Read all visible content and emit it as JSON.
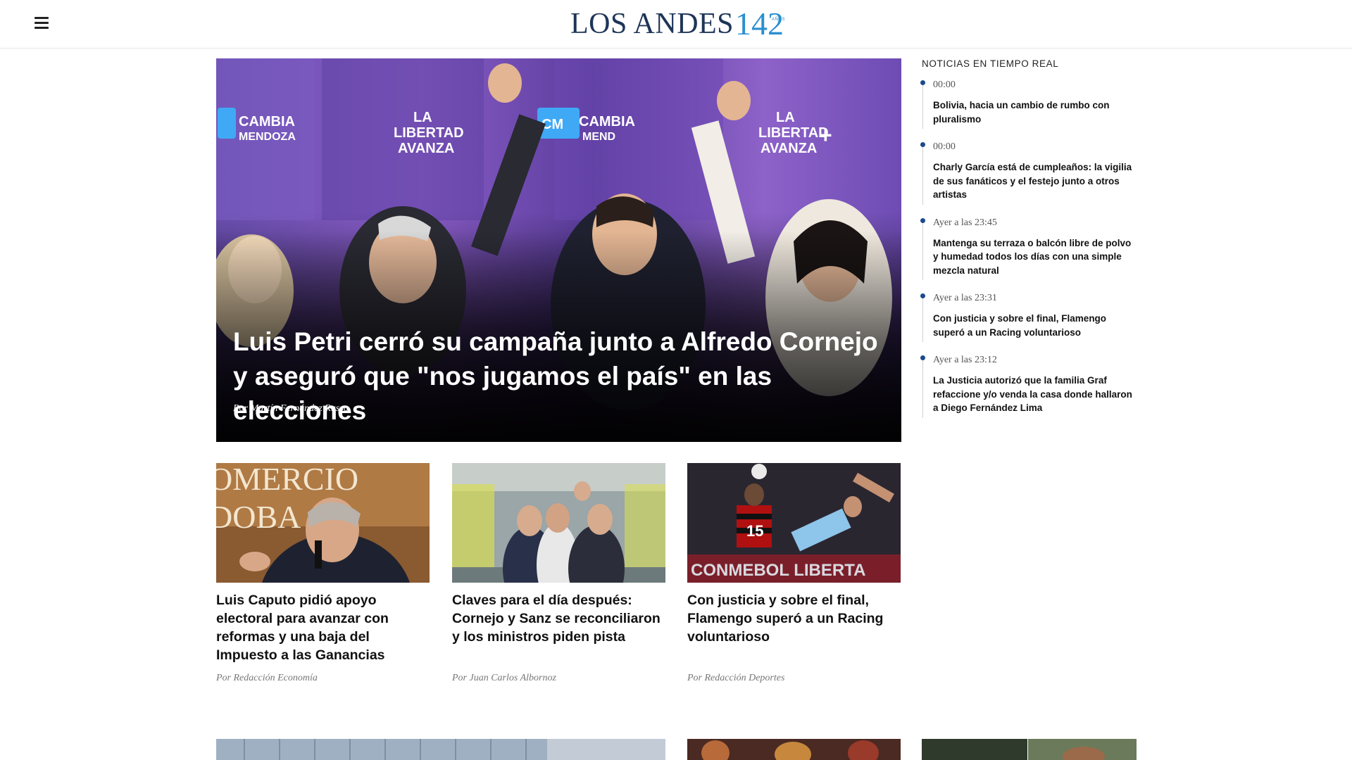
{
  "header": {
    "logo_text": "LOS ANDES",
    "logo_number": "142",
    "logo_anos": "AÑOS",
    "menu_label": "Menú"
  },
  "hero": {
    "title": "Luis Petri cerró su campaña junto a Alfredo Cornejo y aseguró que \"nos jugamos el país\" en las elecciones",
    "byline": "Por Martín Fernández Russo",
    "banner_left_1": "CAMBIA",
    "banner_left_2": "MENDOZA",
    "banner_mid_1": "LA",
    "banner_mid_2": "LIBERTAD",
    "banner_mid_3": "AVANZA"
  },
  "sidebar": {
    "title": "NOTICIAS EN TIEMPO REAL",
    "items": [
      {
        "time": "00:00",
        "headline": "Bolivia, hacia un cambio de rumbo con pluralismo"
      },
      {
        "time": "00:00",
        "headline": "Charly García está de cumpleaños: la vigilia de sus fanáticos y el festejo junto a otros artistas"
      },
      {
        "time": "Ayer a las 23:45",
        "headline": "Mantenga su terraza o balcón libre de polvo y humedad todos los días con una simple mezcla natural"
      },
      {
        "time": "Ayer a las 23:31",
        "headline": "Con justicia y sobre el final, Flamengo superó a un Racing voluntarioso"
      },
      {
        "time": "Ayer a las 23:12",
        "headline": "La Justicia autorizó que la familia Graf refaccione y/o venda la casa donde hallaron a Diego Fernández Lima"
      }
    ]
  },
  "cards": [
    {
      "title": "Luis Caputo pidió apoyo electoral para avanzar con reformas y una baja del Impuesto a las Ganancias",
      "byline": "Por Redacción Economía",
      "img_text": "OMERCIO"
    },
    {
      "title": "Claves para el día después: Cornejo y Sanz se reconciliaron y los ministros piden pista",
      "byline": "Por Juan Carlos Albornoz",
      "img_text": ""
    },
    {
      "title": "Con justicia y sobre el final, Flamengo superó a un Racing voluntarioso",
      "byline": "Por Redacción Deportes",
      "img_text": "CONMEBOL LIBERTA"
    }
  ],
  "colors": {
    "logo_dark": "#1d3557",
    "logo_accent": "#2b8fd0",
    "timeline_dot": "#1c4a8a"
  }
}
